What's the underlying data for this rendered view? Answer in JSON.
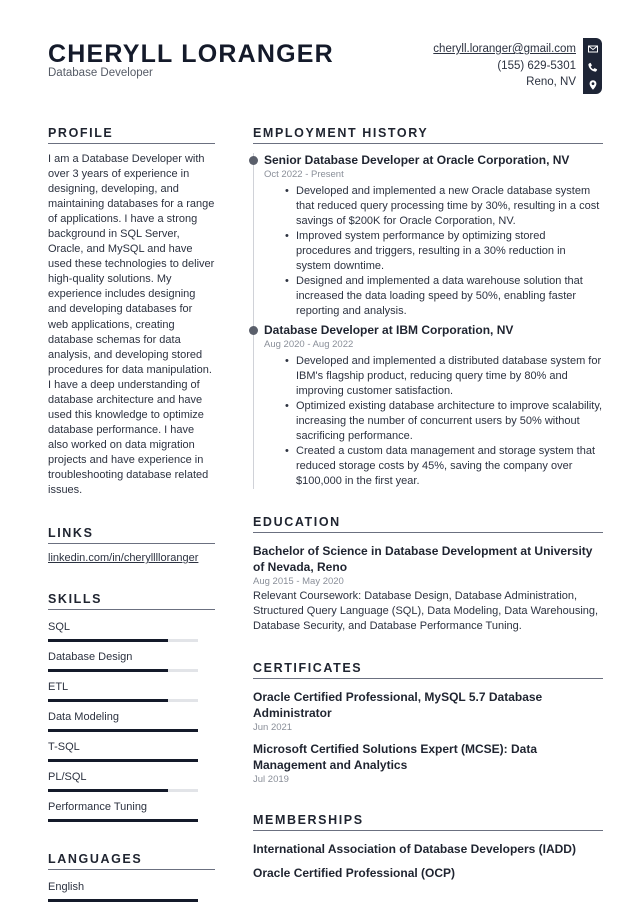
{
  "header": {
    "name": "CHERYLL LORANGER",
    "job_title": "Database Developer",
    "contact": {
      "email": "cheryll.loranger@gmail.com",
      "phone": "(155) 629-5301",
      "location": "Reno, NV",
      "icons": [
        "envelope-icon",
        "phone-icon",
        "map-pin-icon"
      ]
    }
  },
  "left": {
    "profile": {
      "title": "PROFILE",
      "text": "I am a Database Developer with over 3 years of experience in designing, developing, and maintaining databases for a range of applications. I have a strong background in SQL Server, Oracle, and MySQL and have used these technologies to deliver high-quality solutions. My experience includes designing and developing databases for web applications, creating database schemas for data analysis, and developing stored procedures for data manipulation. I have a deep understanding of database architecture and have used this knowledge to optimize database performance. I have also worked on data migration projects and have experience in troubleshooting database related issues."
    },
    "links": {
      "title": "LINKS",
      "items": [
        "linkedin.com/in/cherylllloranger"
      ]
    },
    "skills": {
      "title": "SKILLS",
      "items": [
        {
          "name": "SQL",
          "level": 0.8
        },
        {
          "name": "Database Design",
          "level": 0.8
        },
        {
          "name": "ETL",
          "level": 0.8
        },
        {
          "name": "Data Modeling",
          "level": 1.0
        },
        {
          "name": "T-SQL",
          "level": 1.0
        },
        {
          "name": "PL/SQL",
          "level": 0.8
        },
        {
          "name": "Performance Tuning",
          "level": 1.0
        }
      ]
    },
    "languages": {
      "title": "LANGUAGES",
      "items": [
        {
          "name": "English",
          "level": 1.0
        }
      ]
    }
  },
  "right": {
    "employment": {
      "title": "EMPLOYMENT HISTORY",
      "jobs": [
        {
          "title": "Senior Database Developer at Oracle Corporation, NV",
          "date": "Oct 2022 - Present",
          "bullets": [
            "Developed and implemented a new Oracle database system that reduced query processing time by 30%, resulting in a cost savings of $200K for Oracle Corporation, NV.",
            "Improved system performance by optimizing stored procedures and triggers, resulting in a 30% reduction in system downtime.",
            "Designed and implemented a data warehouse solution that increased the data loading speed by 50%, enabling faster reporting and analysis."
          ]
        },
        {
          "title": "Database Developer at IBM Corporation, NV",
          "date": "Aug 2020 - Aug 2022",
          "bullets": [
            "Developed and implemented a distributed database system for IBM's flagship product, reducing query time by 80% and improving customer satisfaction.",
            "Optimized existing database architecture to improve scalability, increasing the number of concurrent users by 50% without sacrificing performance.",
            "Created a custom data management and storage system that reduced storage costs by 45%, saving the company over $100,000 in the first year."
          ]
        }
      ]
    },
    "education": {
      "title": "EDUCATION",
      "items": [
        {
          "title": "Bachelor of Science in Database Development at University of Nevada, Reno",
          "date": "Aug 2015 - May 2020",
          "desc": "Relevant Coursework: Database Design, Database Administration, Structured Query Language (SQL), Data Modeling, Data Warehousing, Database Security, and Database Performance Tuning."
        }
      ]
    },
    "certificates": {
      "title": "CERTIFICATES",
      "items": [
        {
          "title": "Oracle Certified Professional, MySQL 5.7 Database Administrator",
          "date": "Jun 2021"
        },
        {
          "title": "Microsoft Certified Solutions Expert (MCSE): Data Management and Analytics",
          "date": "Jul 2019"
        }
      ]
    },
    "memberships": {
      "title": "MEMBERSHIPS",
      "items": [
        "International Association of Database Developers (IADD)",
        "Oracle Certified Professional (OCP)"
      ]
    }
  },
  "colors": {
    "primary": "#141a2a",
    "accent_bar": "#1e2536",
    "muted_text": "#8a8f99",
    "track": "#e2e4e8"
  }
}
